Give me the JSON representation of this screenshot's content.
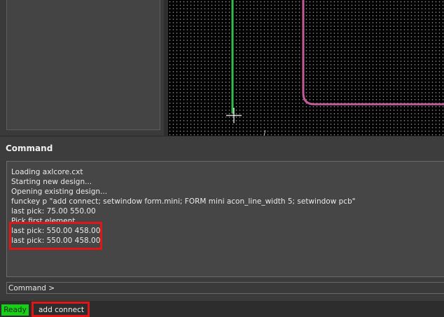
{
  "command_panel": {
    "title": "Command",
    "output_lines": [
      "Loading axlcore.cxt",
      "Starting new design...",
      "Opening existing design...",
      "funckey p \"add connect; setwindow form.mini; FORM mini acon_line_width 5; setwindow pcb\"",
      "last pick:  75.00 550.00",
      "Pick first element",
      "last pick:  550.00 458.00",
      "last pick:  550.00 458.00"
    ],
    "prompt": "Command >"
  },
  "status_bar": {
    "state": "Ready",
    "mode": "add connect"
  },
  "colors": {
    "accent_highlight": "#e01515",
    "ready_badge": "#16d016",
    "trace_green": "#2fbf4f",
    "outline_pink": "#c25c9a",
    "canvas_bg": "#000000"
  }
}
